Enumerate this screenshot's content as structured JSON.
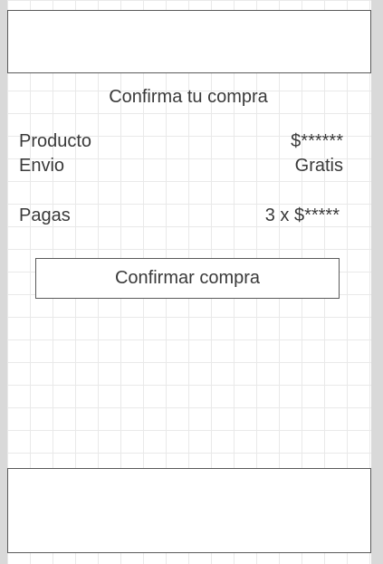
{
  "page": {
    "title": "Confirma tu compra"
  },
  "summary": {
    "producto_label": "Producto",
    "producto_value": "$******",
    "envio_label": "Envio",
    "envio_value": "Gratis",
    "pagas_label": "Pagas",
    "pagas_value": "3 x $*****"
  },
  "actions": {
    "confirm_label": "Confirmar compra"
  },
  "colors": {
    "background": "#d9d9d9",
    "panel": "#ffffff",
    "grid": "#e9e9e9",
    "border": "#5a5a5a",
    "text": "#3a3a3a"
  }
}
